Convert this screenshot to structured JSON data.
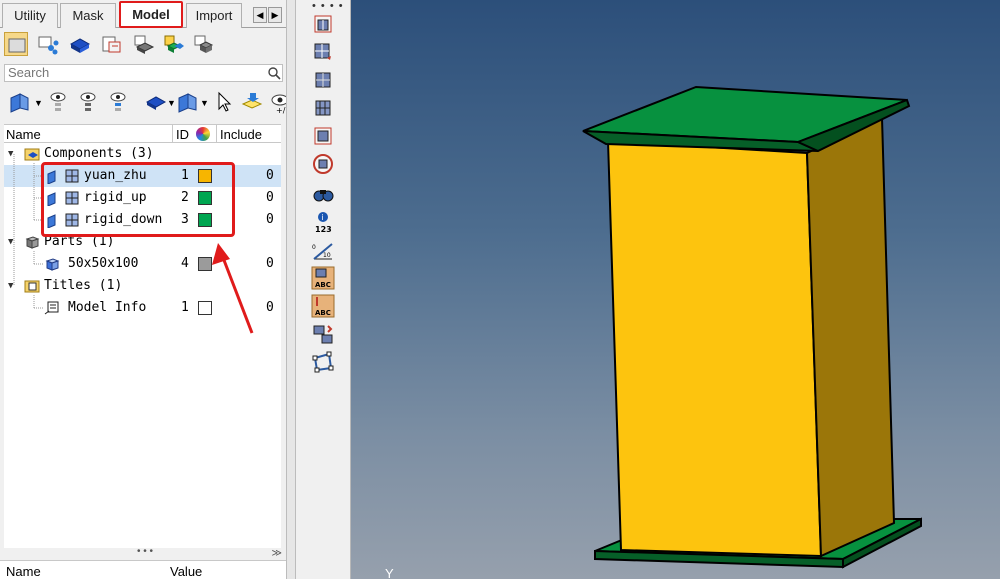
{
  "tabs": [
    {
      "label": "Utility",
      "active": false
    },
    {
      "label": "Mask",
      "active": false
    },
    {
      "label": "Model",
      "active": true
    },
    {
      "label": "Import",
      "active": false
    }
  ],
  "search": {
    "placeholder": "Search"
  },
  "tree": {
    "columns": {
      "name": "Name",
      "id": "ID",
      "include": "Include"
    },
    "groups": [
      {
        "label": "Components (3)",
        "items": [
          {
            "name": "yuan_zhu",
            "id": "1",
            "color": "#f7b500",
            "include": "0",
            "selected": true
          },
          {
            "name": "rigid_up",
            "id": "2",
            "color": "#00a651",
            "include": "0"
          },
          {
            "name": "rigid_down",
            "id": "3",
            "color": "#00a651",
            "include": "0"
          }
        ]
      },
      {
        "label": "Parts (1)",
        "items": [
          {
            "name": "50x50x100",
            "id": "4",
            "color": "#9b9b9b",
            "include": "0"
          }
        ]
      },
      {
        "label": "Titles (1)",
        "items": [
          {
            "name": "Model Info",
            "id": "1",
            "color": "#ffffff",
            "include": "0"
          }
        ]
      }
    ]
  },
  "bottom_panel": {
    "name_col": "Name",
    "value_col": "Value"
  },
  "viewport": {
    "axis_label": "Y"
  },
  "vtoolbar": {
    "info_label": "123",
    "scale_label": "10"
  },
  "colors": {
    "highlight": "#e01b1b",
    "column_color": "#fdc40e",
    "column_side": "#9b7609",
    "plate": "#07913f",
    "selected_row": "#cfe3f6"
  },
  "icons": {
    "toolbar_row_1": [
      "model-view-icon",
      "assembly-icon",
      "component-icon",
      "property-icon",
      "material-icon",
      "include-icon",
      "part-icon"
    ],
    "toolbar_row_2": [
      "display-toggle-icon",
      "show-icon",
      "hide-icon",
      "isolate-icon",
      "component-color-icon",
      "plane-icon",
      "select-cursor-icon",
      "import-icon",
      "view-more-icon"
    ],
    "vertical_toolbar": [
      "mesh-icon",
      "mesh-edit-icon",
      "shaded-icon",
      "wireframe-icon",
      "feature-icon",
      "no-select-icon",
      "find-icon",
      "info-icon",
      "scale-icon",
      "label-abc-icon",
      "label-abc-red-icon",
      "reorder-icon",
      "bounding-icon"
    ]
  }
}
